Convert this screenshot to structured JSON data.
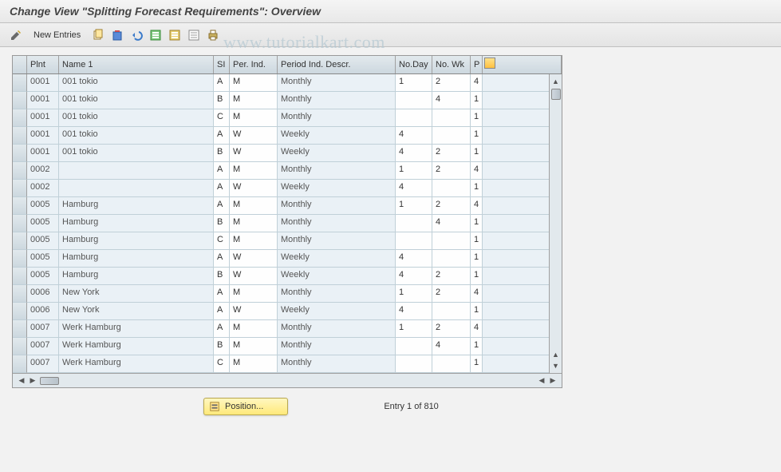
{
  "title": "Change View \"Splitting Forecast Requirements\": Overview",
  "watermark": "www.tutorialkart.com",
  "toolbar": {
    "new_entries": "New Entries"
  },
  "table": {
    "headers": {
      "plnt": "Plnt",
      "name": "Name 1",
      "si": "SI",
      "per_ind": "Per. Ind.",
      "per_desc": "Period Ind. Descr.",
      "no_day": "No.Day",
      "no_wk": "No. Wk",
      "p": "P"
    },
    "rows": [
      {
        "plnt": "0001",
        "name": "001 tokio",
        "si": "A",
        "per": "M",
        "desc": "Monthly",
        "day": "1",
        "wk": "2",
        "p": "4"
      },
      {
        "plnt": "0001",
        "name": "001 tokio",
        "si": "B",
        "per": "M",
        "desc": "Monthly",
        "day": "",
        "wk": "4",
        "p": "1"
      },
      {
        "plnt": "0001",
        "name": "001 tokio",
        "si": "C",
        "per": "M",
        "desc": "Monthly",
        "day": "",
        "wk": "",
        "p": "1"
      },
      {
        "plnt": "0001",
        "name": "001 tokio",
        "si": "A",
        "per": "W",
        "desc": "Weekly",
        "day": "4",
        "wk": "",
        "p": "1"
      },
      {
        "plnt": "0001",
        "name": "001 tokio",
        "si": "B",
        "per": "W",
        "desc": "Weekly",
        "day": "4",
        "wk": "2",
        "p": "1"
      },
      {
        "plnt": "0002",
        "name": "",
        "si": "A",
        "per": "M",
        "desc": "Monthly",
        "day": "1",
        "wk": "2",
        "p": "4"
      },
      {
        "plnt": "0002",
        "name": "",
        "si": "A",
        "per": "W",
        "desc": "Weekly",
        "day": "4",
        "wk": "",
        "p": "1"
      },
      {
        "plnt": "0005",
        "name": "Hamburg",
        "si": "A",
        "per": "M",
        "desc": "Monthly",
        "day": "1",
        "wk": "2",
        "p": "4"
      },
      {
        "plnt": "0005",
        "name": "Hamburg",
        "si": "B",
        "per": "M",
        "desc": "Monthly",
        "day": "",
        "wk": "4",
        "p": "1"
      },
      {
        "plnt": "0005",
        "name": "Hamburg",
        "si": "C",
        "per": "M",
        "desc": "Monthly",
        "day": "",
        "wk": "",
        "p": "1"
      },
      {
        "plnt": "0005",
        "name": "Hamburg",
        "si": "A",
        "per": "W",
        "desc": "Weekly",
        "day": "4",
        "wk": "",
        "p": "1"
      },
      {
        "plnt": "0005",
        "name": "Hamburg",
        "si": "B",
        "per": "W",
        "desc": "Weekly",
        "day": "4",
        "wk": "2",
        "p": "1"
      },
      {
        "plnt": "0006",
        "name": "New York",
        "si": "A",
        "per": "M",
        "desc": "Monthly",
        "day": "1",
        "wk": "2",
        "p": "4"
      },
      {
        "plnt": "0006",
        "name": "New York",
        "si": "A",
        "per": "W",
        "desc": "Weekly",
        "day": "4",
        "wk": "",
        "p": "1"
      },
      {
        "plnt": "0007",
        "name": "Werk Hamburg",
        "si": "A",
        "per": "M",
        "desc": "Monthly",
        "day": "1",
        "wk": "2",
        "p": "4"
      },
      {
        "plnt": "0007",
        "name": "Werk Hamburg",
        "si": "B",
        "per": "M",
        "desc": "Monthly",
        "day": "",
        "wk": "4",
        "p": "1"
      },
      {
        "plnt": "0007",
        "name": "Werk Hamburg",
        "si": "C",
        "per": "M",
        "desc": "Monthly",
        "day": "",
        "wk": "",
        "p": "1"
      }
    ]
  },
  "footer": {
    "position_label": "Position...",
    "entry_text": "Entry 1 of 810"
  }
}
